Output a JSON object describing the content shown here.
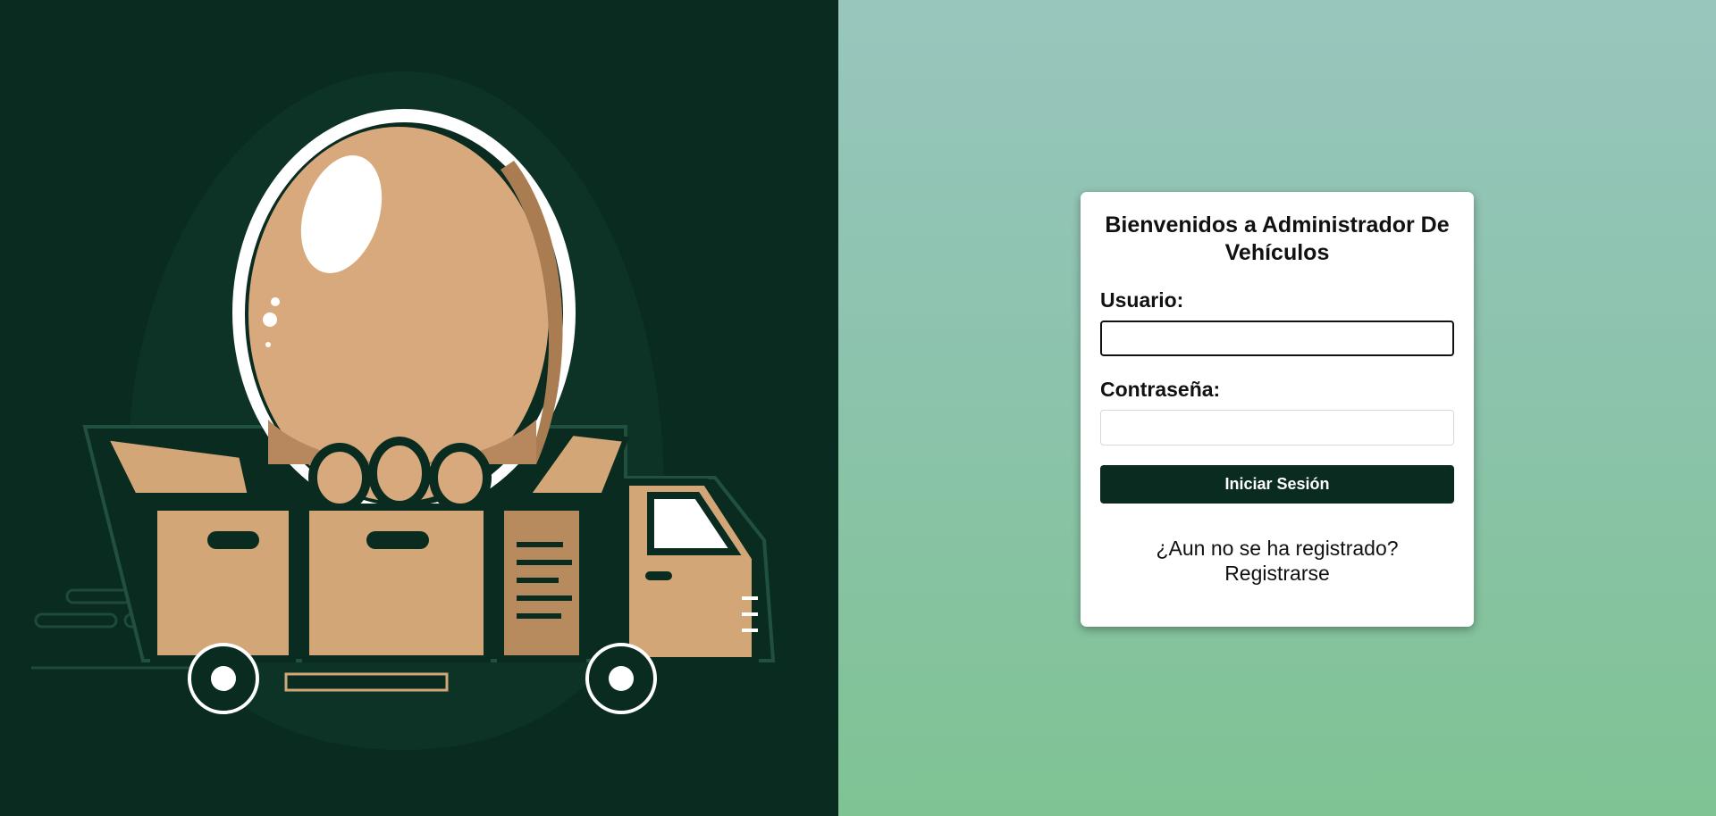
{
  "logo": {
    "icon": "egg-delivery-truck-logo",
    "colors": {
      "background": "#0a2b20",
      "egg": "#d8a97c",
      "egg_shadow": "#a97c52",
      "box": "#d3a677",
      "outline": "#0a2b20",
      "highlight": "#ffffff"
    }
  },
  "login": {
    "title": "Bienvenidos a Administrador De Vehículos",
    "username_label": "Usuario:",
    "username_value": "",
    "password_label": "Contraseña:",
    "password_value": "",
    "submit_label": "Iniciar Sesión",
    "register_prompt": "¿Aun no se ha registrado?",
    "register_link": "Registrarse"
  },
  "colors": {
    "accent": "#0a2b20",
    "card_background": "#ffffff",
    "gradient_top": "#98c6bd",
    "gradient_bottom": "#7fc393"
  }
}
